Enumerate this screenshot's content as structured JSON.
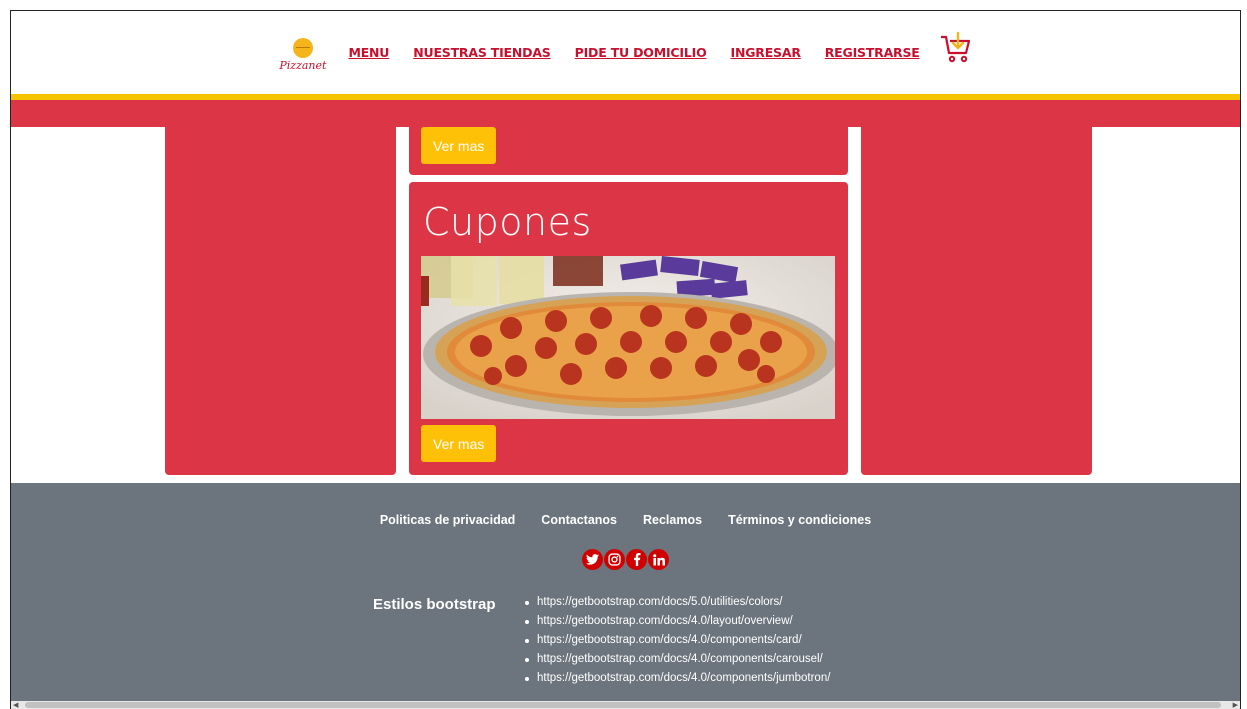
{
  "header": {
    "logo_text": "Pizzanet",
    "nav": [
      "MENU",
      "NUESTRAS TIENDAS",
      "PIDE TU DOMICILIO",
      "INGRESAR",
      "REGISTRARSE"
    ]
  },
  "cards": {
    "top_button": "Ver mas",
    "coupon_title": "Cupones",
    "coupon_button": "Ver mas",
    "coupon_image": "pizza-with-drinks-and-coupons"
  },
  "footer": {
    "links": [
      "Politicas de privacidad",
      "Contactanos",
      "Reclamos",
      "Términos y condiciones"
    ],
    "social": [
      "twitter-icon",
      "instagram-icon",
      "facebook-icon",
      "linkedin-icon"
    ],
    "bootstrap_title": "Estilos bootstrap",
    "bootstrap_links": [
      "https://getbootstrap.com/docs/5.0/utilities/colors/",
      "https://getbootstrap.com/docs/4.0/layout/overview/",
      "https://getbootstrap.com/docs/4.0/components/card/",
      "https://getbootstrap.com/docs/4.0/components/carousel/",
      "https://getbootstrap.com/docs/4.0/components/jumbotron/"
    ]
  },
  "colors": {
    "primary_red": "#dc3545",
    "accent_yellow": "#ffc107",
    "footer_gray": "#6c757d",
    "link_red": "#c8102e"
  }
}
